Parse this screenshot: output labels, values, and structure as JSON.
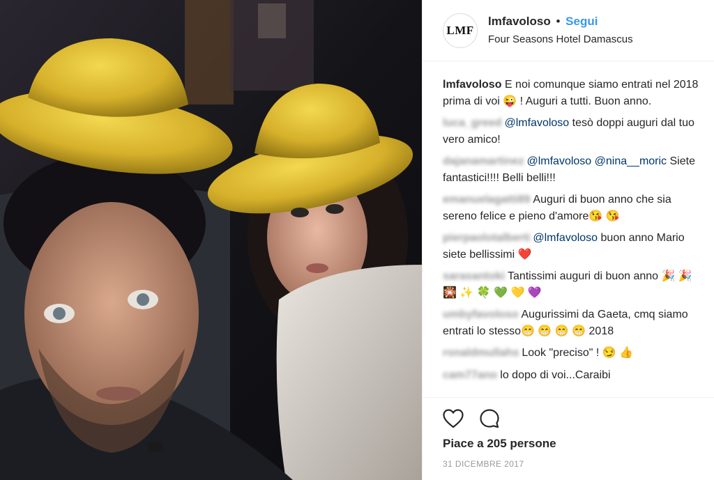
{
  "post": {
    "photo_alt": "Selfie",
    "header": {
      "avatar_text": "LMF",
      "username": "lmfavoloso",
      "separator": "•",
      "follow_label": "Segui",
      "location": "Four Seasons Hotel Damascus"
    },
    "caption": {
      "username": "lmfavoloso",
      "text": "E noi comunque siamo entrati nel 2018 prima di voi 😜 ! Auguri a tutti. Buon anno."
    },
    "comments": [
      {
        "user": "luca_greed",
        "mention": "@lmfavoloso",
        "text": "tesò doppi auguri dal tuo vero amico!"
      },
      {
        "user": "dajanamartinez",
        "mention": "@lmfavoloso @nina__moric",
        "text": "Siete fantastici!!!! Belli belli!!!"
      },
      {
        "user": "emanuelagatti89",
        "mention": "",
        "text": "Auguri di buon anno che sia sereno felice e pieno d'amore😘 😘"
      },
      {
        "user": "pierpaolotalberti",
        "mention": "@lmfavoloso",
        "text": "buon anno Mario siete bellissimi ❤️"
      },
      {
        "user": "sarasantoki",
        "mention": "",
        "text": "Tantissimi auguri di buon anno 🎉 🎉 🎇 ✨ 🍀 💚 💛 💜"
      },
      {
        "user": "umbyfavoloso",
        "mention": "",
        "text": "Augurissimi da Gaeta, cmq siamo entrati lo stesso😁 😁 😁 😁 2018"
      },
      {
        "user": "ronaldmullahs",
        "mention": "",
        "text": "Look \"preciso\" ! 😏 👍"
      },
      {
        "user": "cam77ano",
        "mention": "",
        "text": "lo dopo di voi...Caraibi"
      }
    ],
    "actions": {
      "like_icon": "heart-icon",
      "comment_icon": "comment-icon"
    },
    "likes_text": "Piace a 205 persone",
    "date": "31 DICEMBRE 2017"
  }
}
